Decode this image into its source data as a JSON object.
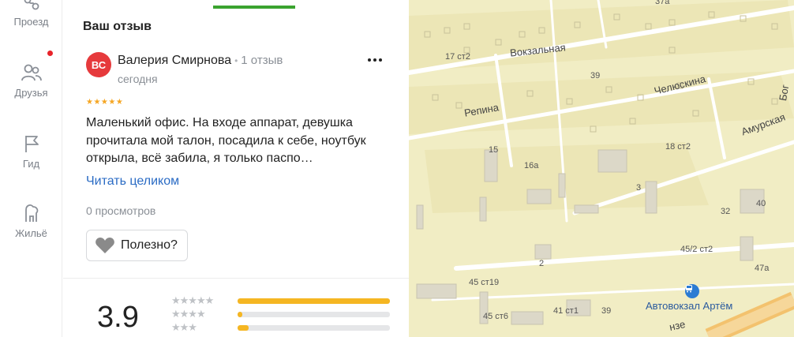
{
  "nav": {
    "items": [
      {
        "label": "Проезд",
        "icon": "route-icon"
      },
      {
        "label": "Друзья",
        "icon": "friends-icon",
        "badge": true
      },
      {
        "label": "Гид",
        "icon": "flag-icon"
      },
      {
        "label": "Жильё",
        "icon": "housing-icon"
      }
    ]
  },
  "review": {
    "section_title": "Ваш отзыв",
    "avatar_initials": "ВС",
    "author_name": "Валерия Смирнова",
    "separator": "•",
    "review_count": "1 отзыв",
    "date": "сегодня",
    "more_label": "•••",
    "stars": "★★★★★",
    "rating_value": 5,
    "text": "Маленький офис. На входе аппарат, девушка прочитала мой талон, посадила к себе, ноутбук открыла, всё забила, я только паспо…",
    "read_more": "Читать целиком",
    "views": "0 просмотров",
    "useful_label": "Полезно?"
  },
  "rating": {
    "average": "3.9",
    "rows": [
      {
        "stars": "★★★★★",
        "fraction": 1.0
      },
      {
        "stars": "★★★★",
        "fraction": 0.03
      },
      {
        "stars": "★★★",
        "fraction": 0.07
      }
    ]
  },
  "map": {
    "streets": [
      "Вокзальная",
      "Репина",
      "Челюскина",
      "Амурская",
      "Бог",
      "нзе"
    ],
    "houses": [
      "37а",
      "17 ст2",
      "39",
      "15",
      "16а",
      "18 ст2",
      "3",
      "32",
      "40",
      "2",
      "45/2 ст2",
      "47а",
      "45 ст19",
      "45 ст6",
      "41 ст1",
      "39"
    ],
    "bus_stop": "Автовокзал Артём",
    "colors": {
      "land": "#f1edc4",
      "road": "#ffffff",
      "block": "#ece6b6",
      "building": "#dcd8c8",
      "bus": "#2b7bd3"
    }
  }
}
